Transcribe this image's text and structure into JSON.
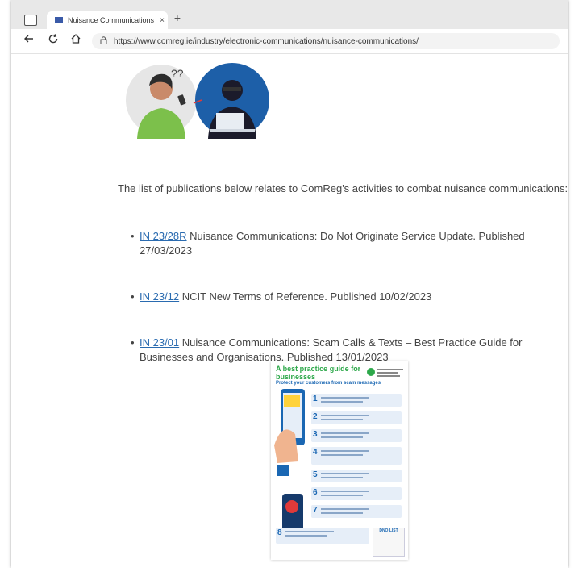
{
  "browser": {
    "tab_title": "Nuisance Communications | Com",
    "tab_close": "×",
    "new_tab": "+",
    "url": "https://www.comreg.ie/industry/electronic-communications/nuisance-communications/"
  },
  "icons": {
    "back": "back-arrow-icon",
    "refresh": "refresh-icon",
    "home": "home-icon",
    "lock": "lock-icon"
  },
  "page": {
    "intro": "The list of publications below relates to ComReg's activities to combat nuisance communications:",
    "publications": [
      {
        "link": "IN 23/28R",
        "text": " Nuisance Communications: Do Not Originate Service Update. Published 27/03/2023"
      },
      {
        "link": "IN 23/12",
        "text": " NCIT New Terms of Reference. Published 10/02/2023"
      },
      {
        "link": "IN 23/01",
        "text": " Nuisance Communications: Scam Calls & Texts – Best Practice Guide for Businesses and Organisations. Published 13/01/2023"
      }
    ]
  },
  "poster": {
    "title": "A best practice guide for businesses",
    "subtitle": "Protect your customers from scam messages",
    "steps": [
      "1",
      "2",
      "3",
      "4",
      "5",
      "6",
      "7",
      "8"
    ],
    "dnc_label": "DNO LIST"
  },
  "colors": {
    "link": "#2a6bb0",
    "poster_green": "#2da84a",
    "poster_blue": "#1a67b3",
    "hero_green": "#7cc04b",
    "hero_blue": "#1d5fa8"
  }
}
